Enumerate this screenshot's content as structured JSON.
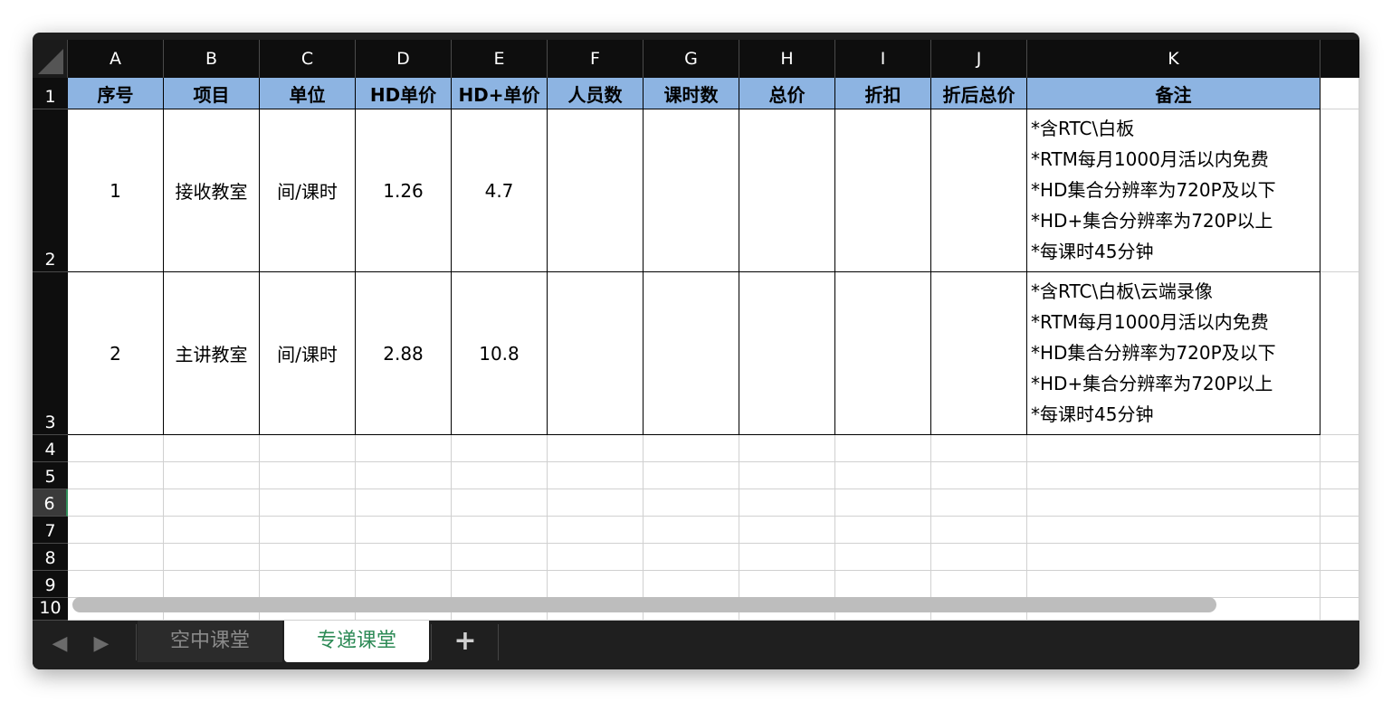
{
  "columns": [
    "A",
    "B",
    "C",
    "D",
    "E",
    "F",
    "G",
    "H",
    "I",
    "J",
    "K"
  ],
  "rows": [
    "1",
    "2",
    "3",
    "4",
    "5",
    "6",
    "7",
    "8",
    "9",
    "10"
  ],
  "active_row": "6",
  "header_row": [
    "序号",
    "项目",
    "单位",
    "HD单价",
    "HD+单价",
    "人员数",
    "课时数",
    "总价",
    "折扣",
    "折后总价",
    "备注"
  ],
  "data_rows": [
    {
      "cells": [
        "1",
        "接收教室",
        "间/课时",
        "1.26",
        "4.7",
        "",
        "",
        "",
        "",
        ""
      ],
      "notes": [
        "*含RTC\\白板",
        "*RTM每月1000月活以内免费",
        "*HD集合分辨率为720P及以下",
        "*HD+集合分辨率为720P以上",
        "*每课时45分钟"
      ]
    },
    {
      "cells": [
        "2",
        "主讲教室",
        "间/课时",
        "2.88",
        "10.8",
        "",
        "",
        "",
        "",
        ""
      ],
      "notes": [
        "*含RTC\\白板\\云端录像",
        "*RTM每月1000月活以内免费",
        "*HD集合分辨率为720P及以下",
        "*HD+集合分辨率为720P以上",
        "*每课时45分钟"
      ]
    }
  ],
  "sheet_tabs": [
    {
      "label": "空中课堂",
      "active": false
    },
    {
      "label": "专递课堂",
      "active": true
    }
  ],
  "add_tab_label": "+",
  "nav": {
    "prev": "◀",
    "next": "▶"
  },
  "colors": {
    "header_fill": "#8db4e2",
    "active_tab_text": "#2e8b57"
  }
}
